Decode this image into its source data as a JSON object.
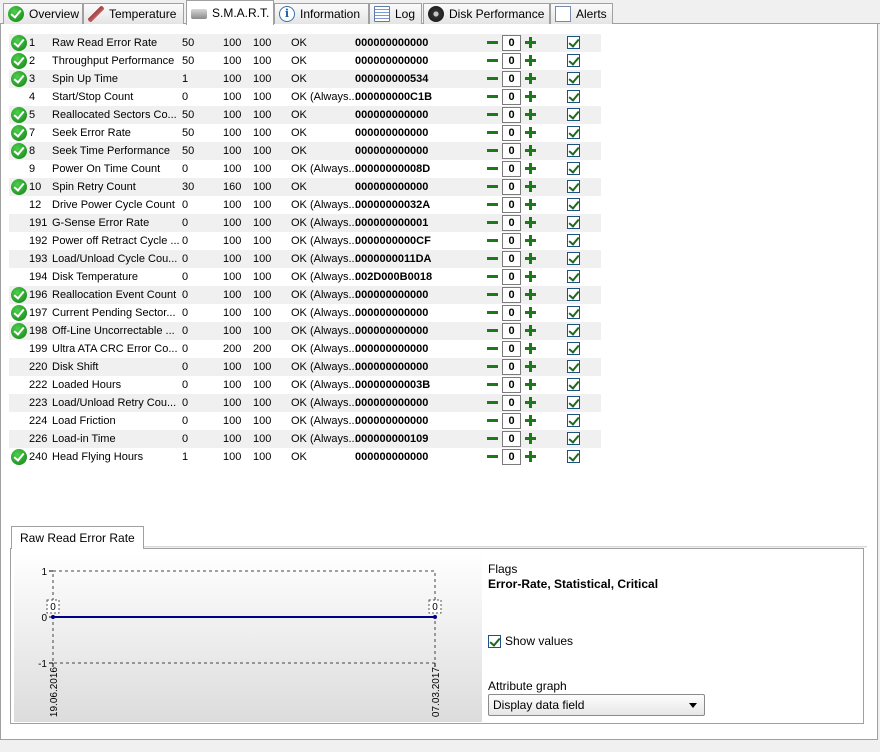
{
  "tabs": [
    {
      "label": "Overview",
      "icon": "check-circle-icon",
      "active": false
    },
    {
      "label": "Temperature",
      "icon": "thermometer-icon",
      "active": false
    },
    {
      "label": "S.M.A.R.T.",
      "icon": "drive-icon",
      "active": true
    },
    {
      "label": "Information",
      "icon": "info-icon",
      "active": false
    },
    {
      "label": "Log",
      "icon": "log-icon",
      "active": false
    },
    {
      "label": "Disk Performance",
      "icon": "disk-gauge-icon",
      "active": false
    },
    {
      "label": "Alerts",
      "icon": "alerts-page-icon",
      "active": false
    }
  ],
  "smart": {
    "rows": [
      {
        "ok": true,
        "id": "1",
        "name": "Raw Read Error Rate",
        "value": "50",
        "worst": "100",
        "threshold": "100",
        "status": "OK",
        "raw": "000000000000",
        "offset": "0",
        "checked": true
      },
      {
        "ok": true,
        "id": "2",
        "name": "Throughput Performance",
        "value": "50",
        "worst": "100",
        "threshold": "100",
        "status": "OK",
        "raw": "000000000000",
        "offset": "0",
        "checked": true
      },
      {
        "ok": true,
        "id": "3",
        "name": "Spin Up Time",
        "value": "1",
        "worst": "100",
        "threshold": "100",
        "status": "OK",
        "raw": "000000000534",
        "offset": "0",
        "checked": true
      },
      {
        "ok": false,
        "id": "4",
        "name": "Start/Stop Count",
        "value": "0",
        "worst": "100",
        "threshold": "100",
        "status": "OK (Always...",
        "raw": "000000000C1B",
        "offset": "0",
        "checked": true
      },
      {
        "ok": true,
        "id": "5",
        "name": "Reallocated Sectors Co...",
        "value": "50",
        "worst": "100",
        "threshold": "100",
        "status": "OK",
        "raw": "000000000000",
        "offset": "0",
        "checked": true
      },
      {
        "ok": true,
        "id": "7",
        "name": "Seek Error Rate",
        "value": "50",
        "worst": "100",
        "threshold": "100",
        "status": "OK",
        "raw": "000000000000",
        "offset": "0",
        "checked": true
      },
      {
        "ok": true,
        "id": "8",
        "name": "Seek Time Performance",
        "value": "50",
        "worst": "100",
        "threshold": "100",
        "status": "OK",
        "raw": "000000000000",
        "offset": "0",
        "checked": true
      },
      {
        "ok": false,
        "id": "9",
        "name": "Power On Time Count",
        "value": "0",
        "worst": "100",
        "threshold": "100",
        "status": "OK (Always...",
        "raw": "00000000008D",
        "offset": "0",
        "checked": true
      },
      {
        "ok": true,
        "id": "10",
        "name": "Spin Retry Count",
        "value": "30",
        "worst": "160",
        "threshold": "100",
        "status": "OK",
        "raw": "000000000000",
        "offset": "0",
        "checked": true
      },
      {
        "ok": false,
        "id": "12",
        "name": "Drive Power Cycle Count",
        "value": "0",
        "worst": "100",
        "threshold": "100",
        "status": "OK (Always...",
        "raw": "00000000032A",
        "offset": "0",
        "checked": true
      },
      {
        "ok": false,
        "id": "191",
        "name": "G-Sense Error Rate",
        "value": "0",
        "worst": "100",
        "threshold": "100",
        "status": "OK (Always...",
        "raw": "000000000001",
        "offset": "0",
        "checked": true
      },
      {
        "ok": false,
        "id": "192",
        "name": "Power off Retract Cycle ...",
        "value": "0",
        "worst": "100",
        "threshold": "100",
        "status": "OK (Always...",
        "raw": "0000000000CF",
        "offset": "0",
        "checked": true
      },
      {
        "ok": false,
        "id": "193",
        "name": "Load/Unload Cycle Cou...",
        "value": "0",
        "worst": "100",
        "threshold": "100",
        "status": "OK (Always...",
        "raw": "0000000011DA",
        "offset": "0",
        "checked": true
      },
      {
        "ok": false,
        "id": "194",
        "name": "Disk Temperature",
        "value": "0",
        "worst": "100",
        "threshold": "100",
        "status": "OK (Always...",
        "raw": "002D000B0018",
        "offset": "0",
        "checked": true
      },
      {
        "ok": true,
        "id": "196",
        "name": "Reallocation Event Count",
        "value": "0",
        "worst": "100",
        "threshold": "100",
        "status": "OK (Always...",
        "raw": "000000000000",
        "offset": "0",
        "checked": true
      },
      {
        "ok": true,
        "id": "197",
        "name": "Current Pending Sector...",
        "value": "0",
        "worst": "100",
        "threshold": "100",
        "status": "OK (Always...",
        "raw": "000000000000",
        "offset": "0",
        "checked": true
      },
      {
        "ok": true,
        "id": "198",
        "name": "Off-Line Uncorrectable ...",
        "value": "0",
        "worst": "100",
        "threshold": "100",
        "status": "OK (Always...",
        "raw": "000000000000",
        "offset": "0",
        "checked": true
      },
      {
        "ok": false,
        "id": "199",
        "name": "Ultra ATA CRC Error Co...",
        "value": "0",
        "worst": "200",
        "threshold": "200",
        "status": "OK (Always...",
        "raw": "000000000000",
        "offset": "0",
        "checked": true
      },
      {
        "ok": false,
        "id": "220",
        "name": "Disk Shift",
        "value": "0",
        "worst": "100",
        "threshold": "100",
        "status": "OK (Always...",
        "raw": "000000000000",
        "offset": "0",
        "checked": true
      },
      {
        "ok": false,
        "id": "222",
        "name": "Loaded Hours",
        "value": "0",
        "worst": "100",
        "threshold": "100",
        "status": "OK (Always...",
        "raw": "00000000003B",
        "offset": "0",
        "checked": true
      },
      {
        "ok": false,
        "id": "223",
        "name": "Load/Unload Retry Cou...",
        "value": "0",
        "worst": "100",
        "threshold": "100",
        "status": "OK (Always...",
        "raw": "000000000000",
        "offset": "0",
        "checked": true
      },
      {
        "ok": false,
        "id": "224",
        "name": "Load Friction",
        "value": "0",
        "worst": "100",
        "threshold": "100",
        "status": "OK (Always...",
        "raw": "000000000000",
        "offset": "0",
        "checked": true
      },
      {
        "ok": false,
        "id": "226",
        "name": "Load-in Time",
        "value": "0",
        "worst": "100",
        "threshold": "100",
        "status": "OK (Always...",
        "raw": "000000000109",
        "offset": "0",
        "checked": true
      },
      {
        "ok": true,
        "id": "240",
        "name": "Head Flying Hours",
        "value": "1",
        "worst": "100",
        "threshold": "100",
        "status": "OK",
        "raw": "000000000000",
        "offset": "0",
        "checked": true
      }
    ]
  },
  "detail": {
    "tab_label": "Raw Read Error Rate",
    "flags_label": "Flags",
    "flags_value": "Error-Rate, Statistical, Critical",
    "show_values_label": "Show values",
    "show_values_checked": true,
    "attribute_graph_label": "Attribute graph",
    "attribute_graph_selected": "Display data field"
  },
  "chart_data": {
    "type": "line",
    "x": [
      "19.06.2016",
      "07.03.2017"
    ],
    "series": [
      {
        "values": [
          0,
          0
        ]
      }
    ],
    "point_labels": [
      "0",
      "0"
    ],
    "ylim": [
      -1,
      1
    ],
    "yticks": [
      "1",
      "0",
      "-1"
    ],
    "line_color": "#00008b",
    "grid": true
  }
}
